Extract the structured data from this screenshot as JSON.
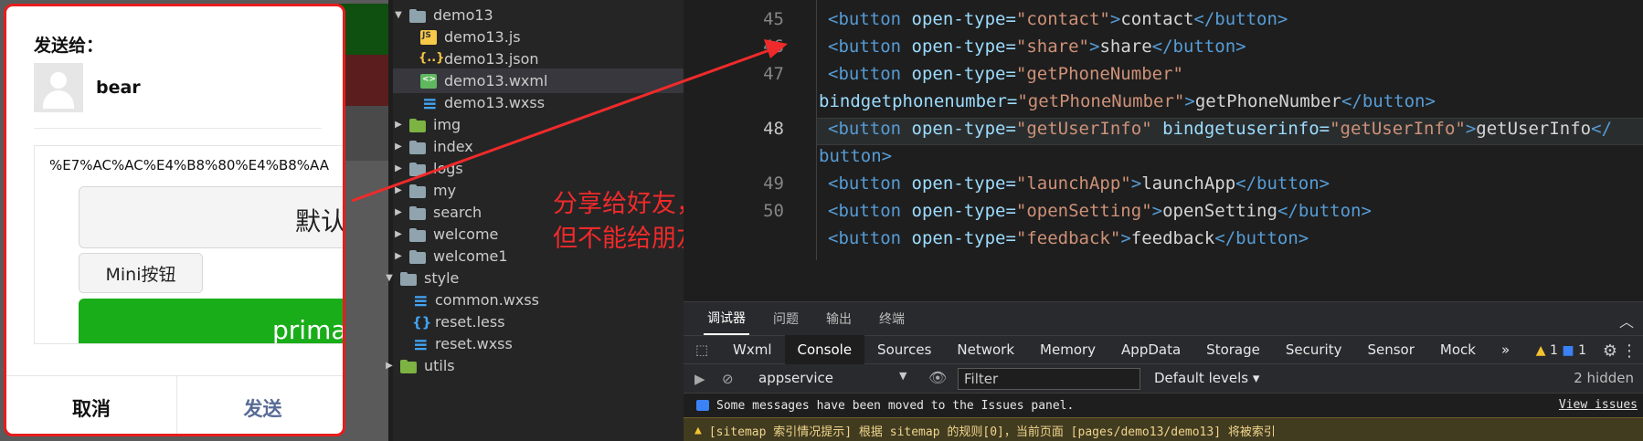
{
  "dialog": {
    "title": "发送给：",
    "user_name": "bear",
    "preview_url": "%E7%AC%AC%E4%B8%80%E4%B8%AA",
    "btn_default": "默认",
    "btn_mini": "Mini按钮",
    "btn_primary": "prima",
    "cancel": "取消",
    "send": "发送",
    "border_color": "#e81c1c",
    "send_color": "#576b95"
  },
  "tree": {
    "items": [
      {
        "label": "demo13",
        "icon": "folder-open-icon"
      },
      {
        "label": "demo13.js",
        "icon": "js-file-icon"
      },
      {
        "label": "demo13.json",
        "icon": "json-file-icon"
      },
      {
        "label": "demo13.wxml",
        "icon": "wxml-file-icon"
      },
      {
        "label": "demo13.wxss",
        "icon": "wxss-file-icon"
      },
      {
        "label": "img",
        "icon": "folder-icon"
      },
      {
        "label": "index",
        "icon": "folder-icon"
      },
      {
        "label": "logs",
        "icon": "folder-icon"
      },
      {
        "label": "my",
        "icon": "folder-icon"
      },
      {
        "label": "search",
        "icon": "folder-icon"
      },
      {
        "label": "welcome",
        "icon": "folder-icon"
      },
      {
        "label": "welcome1",
        "icon": "folder-icon"
      },
      {
        "label": "style",
        "icon": "folder-open-icon"
      },
      {
        "label": "common.wxss",
        "icon": "wxss-file-icon"
      },
      {
        "label": "reset.less",
        "icon": "less-file-icon"
      },
      {
        "label": "reset.wxss",
        "icon": "wxss-file-icon"
      },
      {
        "label": "utils",
        "icon": "folder-icon"
      }
    ]
  },
  "annotation": {
    "line1": "分享给好友，",
    "line2": "但不能给朋友圈",
    "color": "#f02a2a"
  },
  "editor": {
    "line_numbers": [
      "45",
      "46",
      "47",
      "48",
      "49",
      "50"
    ],
    "lines": [
      {
        "tag_open": "<button",
        "attr": " open-type=",
        "val": "\"contact\"",
        "close_bracket": ">",
        "text": "contact",
        "tag_close": "</button>"
      },
      {
        "tag_open": "<button",
        "attr": " open-type=",
        "val": "\"share\"",
        "close_bracket": ">",
        "text": "share",
        "tag_close": "</button>"
      },
      {
        "tag_open": "<button",
        "attr": " open-type=",
        "val": "\"getPhoneNumber\""
      },
      {
        "attr": "bindgetphonenumber=",
        "val": "\"getPhoneNumber\"",
        "close_bracket": ">",
        "text": "getPhoneNumber",
        "tag_close": "</button>"
      },
      {
        "tag_open": "<button",
        "attr": " open-type=",
        "val": "\"getUserInfo\"",
        "attr2": " bindgetuserinfo=",
        "val2": "\"getUserInfo\"",
        "close_bracket": ">",
        "text": "getUserInfo",
        "tag_close": "</"
      },
      {
        "tag_open": "button",
        "close_bracket": ">"
      },
      {
        "tag_open": "<button",
        "attr": " open-type=",
        "val": "\"launchApp\"",
        "close_bracket": ">",
        "text": "launchApp",
        "tag_close": "</button>"
      },
      {
        "tag_open": "<button",
        "attr": " open-type=",
        "val": "\"openSetting\"",
        "close_bracket": ">",
        "text": "openSetting",
        "tag_close": "</button>"
      },
      {
        "tag_open": "<button",
        "attr": " open-type=",
        "val": "\"feedback\"",
        "close_bracket": ">",
        "text": "feedback",
        "tag_close": "</button>"
      }
    ]
  },
  "devtools": {
    "top_tabs": [
      "调试器",
      "问题",
      "输出",
      "终端"
    ],
    "tabs": [
      "Wxml",
      "Console",
      "Sources",
      "Network",
      "Memory",
      "AppData",
      "Storage",
      "Security",
      "Sensor",
      "Mock"
    ],
    "active_tab": "Console",
    "more_tabs": "»",
    "warn_count": "1",
    "info_count": "1",
    "context": "appservice",
    "filter_placeholder": "Filter",
    "levels": "Default levels",
    "hidden": "2 hidden",
    "message1": "Some messages have been moved to the Issues panel.",
    "message1_link": "View issues",
    "message2": "[sitemap 索引情况提示] 根据 sitemap 的规则[0]，当前页面 [pages/demo13/demo13] 将被索引"
  }
}
